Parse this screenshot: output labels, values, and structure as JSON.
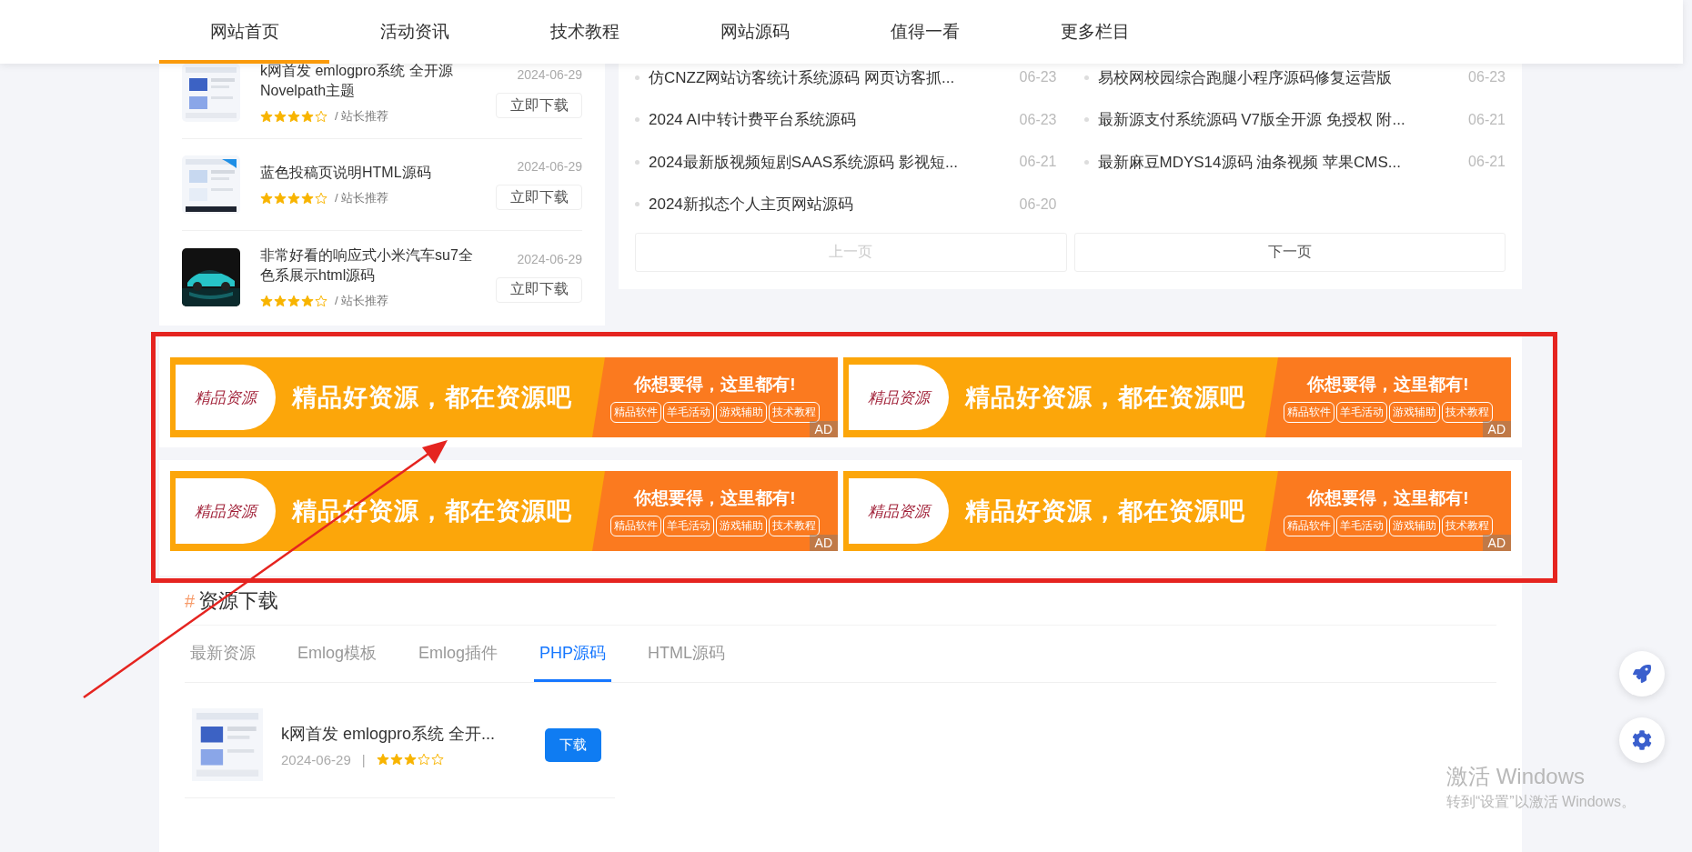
{
  "nav": {
    "tabs": [
      {
        "label": "网站首页",
        "selected": true
      },
      {
        "label": "活动资讯",
        "selected": false
      },
      {
        "label": "技术教程",
        "selected": false
      },
      {
        "label": "网站源码",
        "selected": false
      },
      {
        "label": "值得一看",
        "selected": false
      },
      {
        "label": "更多栏目",
        "selected": false
      }
    ]
  },
  "featured": {
    "items": [
      {
        "title": "k网首发 emlogpro系统 全开源Novelpath主题",
        "date": "2024-06-29",
        "stars": 4,
        "tag": "/ 站长推荐",
        "button": "立即下载"
      },
      {
        "title": "蓝色投稿页说明HTML源码",
        "date": "2024-06-29",
        "stars": 4,
        "tag": "/ 站长推荐",
        "button": "立即下载"
      },
      {
        "title": "非常好看的响应式小米汽车su7全色系展示html源码",
        "date": "2024-06-29",
        "stars": 4,
        "tag": "/ 站长推荐",
        "button": "立即下载"
      }
    ]
  },
  "news": {
    "items": [
      {
        "title": "仿CNZZ网站访客统计系统源码 网页访客抓...",
        "date": "06-23"
      },
      {
        "title": "易校网校园综合跑腿小程序源码修复运营版",
        "date": "06-23"
      },
      {
        "title": "2024 AI中转计费平台系统源码",
        "date": "06-23"
      },
      {
        "title": "最新源支付系统源码 V7版全开源 免授权 附...",
        "date": "06-21"
      },
      {
        "title": "2024最新版视频短剧SAAS系统源码 影视短...",
        "date": "06-21"
      },
      {
        "title": "最新麻豆MDYS14源码 油条视频 苹果CMS...",
        "date": "06-21"
      },
      {
        "title": "2024新拟态个人主页网站源码",
        "date": "06-20"
      }
    ],
    "pager": [
      {
        "label": "上一页",
        "disabled": true
      },
      {
        "label": "下一页",
        "disabled": false
      }
    ]
  },
  "ads": [
    {
      "logo": "精品资源",
      "headline": "精品好资源，都在资源吧",
      "slogan": "你想要得，这里都有!",
      "tags": [
        "精品软件",
        "羊毛活动",
        "游戏辅助",
        "技术教程"
      ],
      "badge": "AD"
    },
    {
      "logo": "精品资源",
      "headline": "精品好资源，都在资源吧",
      "slogan": "你想要得，这里都有!",
      "tags": [
        "精品软件",
        "羊毛活动",
        "游戏辅助",
        "技术教程"
      ],
      "badge": "AD"
    },
    {
      "logo": "精品资源",
      "headline": "精品好资源，都在资源吧",
      "slogan": "你想要得，这里都有!",
      "tags": [
        "精品软件",
        "羊毛活动",
        "游戏辅助",
        "技术教程"
      ],
      "badge": "AD"
    },
    {
      "logo": "精品资源",
      "headline": "精品好资源，都在资源吧",
      "slogan": "你想要得，这里都有!",
      "tags": [
        "精品软件",
        "羊毛活动",
        "游戏辅助",
        "技术教程"
      ],
      "badge": "AD"
    }
  ],
  "resources": {
    "marker": "#",
    "heading": "资源下载",
    "tabs": [
      {
        "label": "最新资源",
        "selected": false
      },
      {
        "label": "Emlog模板",
        "selected": false
      },
      {
        "label": "Emlog插件",
        "selected": false
      },
      {
        "label": "PHP源码",
        "selected": true
      },
      {
        "label": "HTML源码",
        "selected": false
      }
    ],
    "items": [
      {
        "title": "k网首发 emlogpro系统 全开...",
        "date": "2024-06-29",
        "separator": "|",
        "stars": 3,
        "button": "下载"
      }
    ]
  },
  "os_notice": {
    "title": "激活 Windows",
    "subtitle": "转到“设置”以激活 Windows。"
  }
}
